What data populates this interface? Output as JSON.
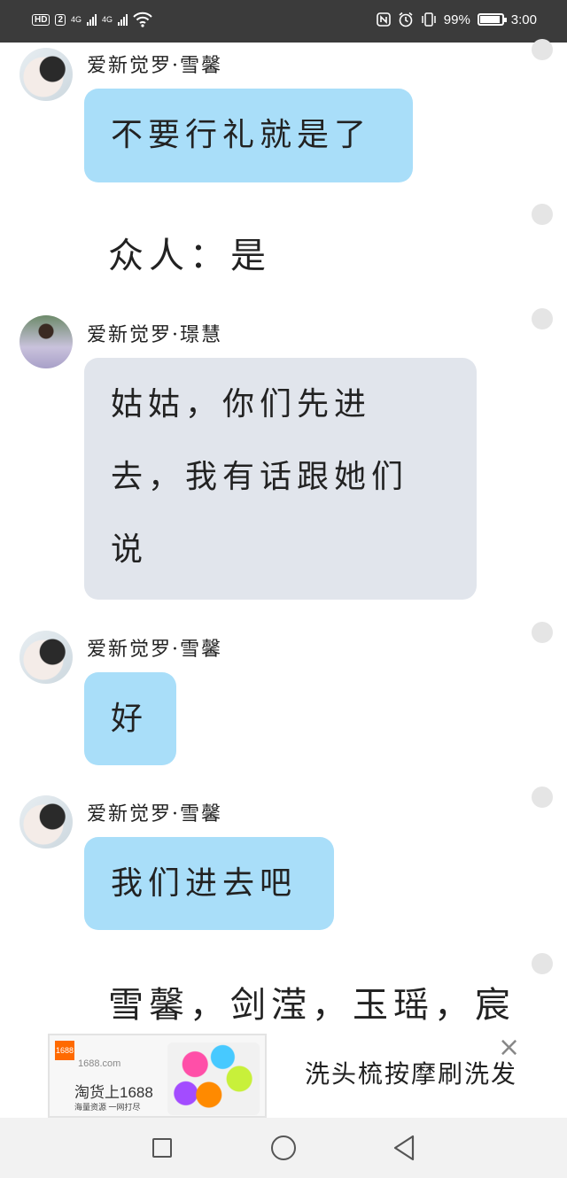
{
  "status_bar": {
    "hd_badge": "HD",
    "sim": "2",
    "net1": "4G",
    "net2": "4G",
    "battery_percent": "99%",
    "battery_level": 0.99,
    "time": "3:00"
  },
  "messages": [
    {
      "sender": "爱新觉罗·雪馨",
      "text": "不要行礼就是了"
    },
    {
      "narration": "众人：是"
    },
    {
      "sender": "爱新觉罗·璟慧",
      "lines": [
        "姑姑，你们先进",
        "去，我有话跟她们",
        "说"
      ]
    },
    {
      "sender": "爱新觉罗·雪馨",
      "text": "好"
    },
    {
      "sender": "爱新觉罗·雪馨",
      "text": "我们进去吧"
    },
    {
      "narration": "雪馨，剑滢，玉瑶，宸"
    }
  ],
  "ad": {
    "logo": "1688",
    "url": "1688.com",
    "main": "淘货上1688",
    "sub": "海量资源 一网打尽",
    "close": "×",
    "title": "洗头梳按摩刷洗发"
  },
  "icons": [
    "hd-icon",
    "signal-icon",
    "nfc-icon",
    "alarm-icon",
    "vibrate-icon",
    "battery-icon",
    "wifi-icon"
  ],
  "colors": {
    "bubble_blue": "#a9def9",
    "bubble_grey": "#e1e5ec",
    "status_bar": "#3b3b3b"
  }
}
